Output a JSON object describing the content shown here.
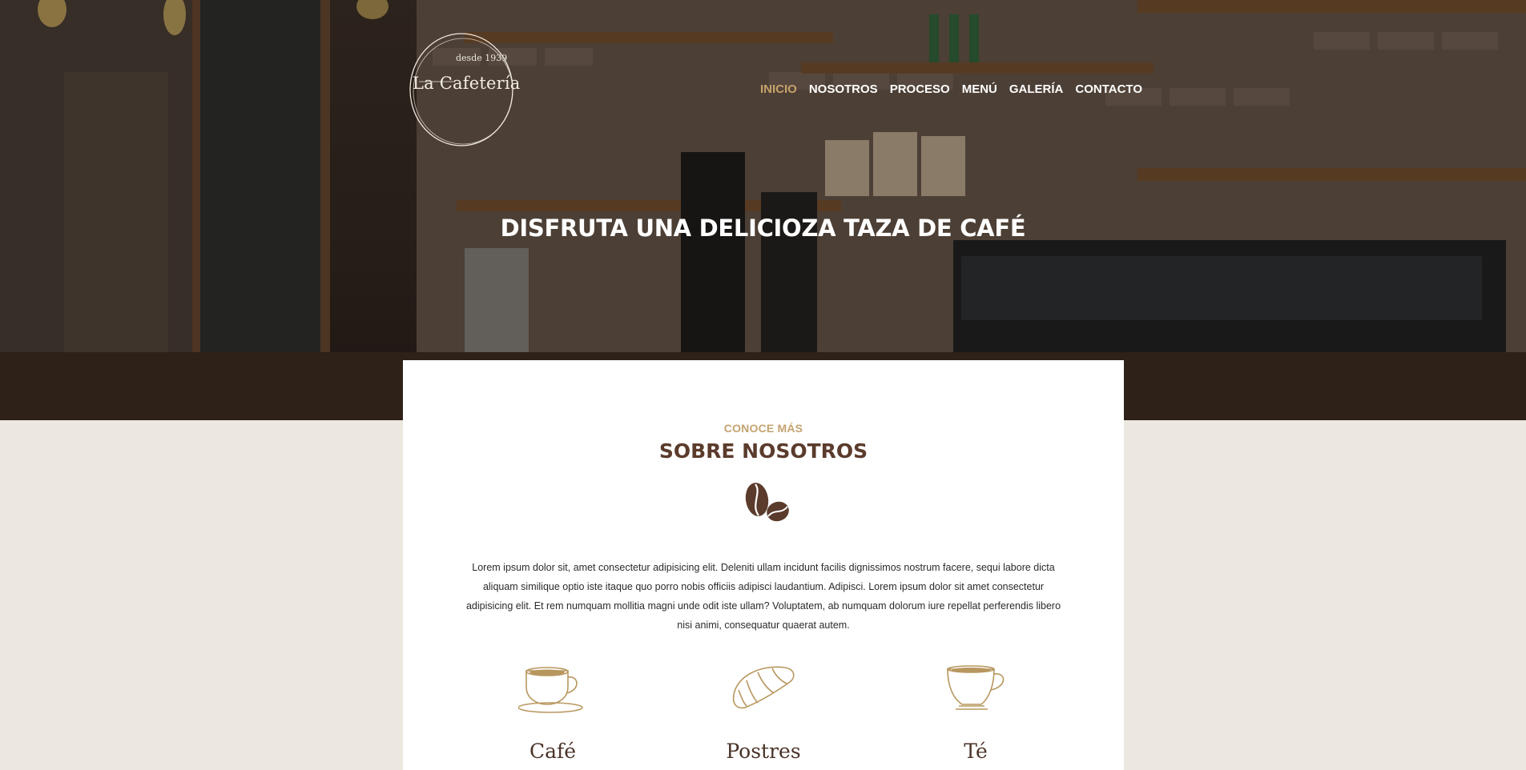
{
  "brand": {
    "since": "desde 1939",
    "name": "La Cafetería"
  },
  "nav": {
    "items": [
      {
        "label": "INICIO",
        "active": true
      },
      {
        "label": "NOSOTROS",
        "active": false
      },
      {
        "label": "PROCESO",
        "active": false
      },
      {
        "label": "MENÚ",
        "active": false
      },
      {
        "label": "GALERÍA",
        "active": false
      },
      {
        "label": "CONTACTO",
        "active": false
      }
    ]
  },
  "hero": {
    "title": "DISFRUTA UNA DELICIOZA TAZA DE CAFÉ"
  },
  "about": {
    "eyebrow": "CONOCE MÁS",
    "title": "SOBRE NOSOTROS",
    "text": "Lorem ipsum dolor sit, amet consectetur adipisicing elit. Deleniti ullam incidunt facilis dignissimos nostrum facere, sequi labore dicta aliquam similique optio iste itaque quo porro nobis officiis adipisci laudantium. Adipisci. Lorem ipsum dolor sit amet consectetur adipisicing elit. Et rem numquam mollitia magni unde odit iste ullam? Voluptatem, ab numquam dolorum iure repellat perferendis libero nisi animi, consequatur quaerat autem."
  },
  "features": [
    {
      "label": "Café",
      "icon": "coffee-cup-icon"
    },
    {
      "label": "Postres",
      "icon": "croissant-icon"
    },
    {
      "label": "Té",
      "icon": "tea-cup-icon"
    }
  ],
  "colors": {
    "accent": "#c6a26a",
    "heading": "#5b3b2c",
    "page_background": "#ece7df",
    "icon_gold": "#b8975f"
  }
}
